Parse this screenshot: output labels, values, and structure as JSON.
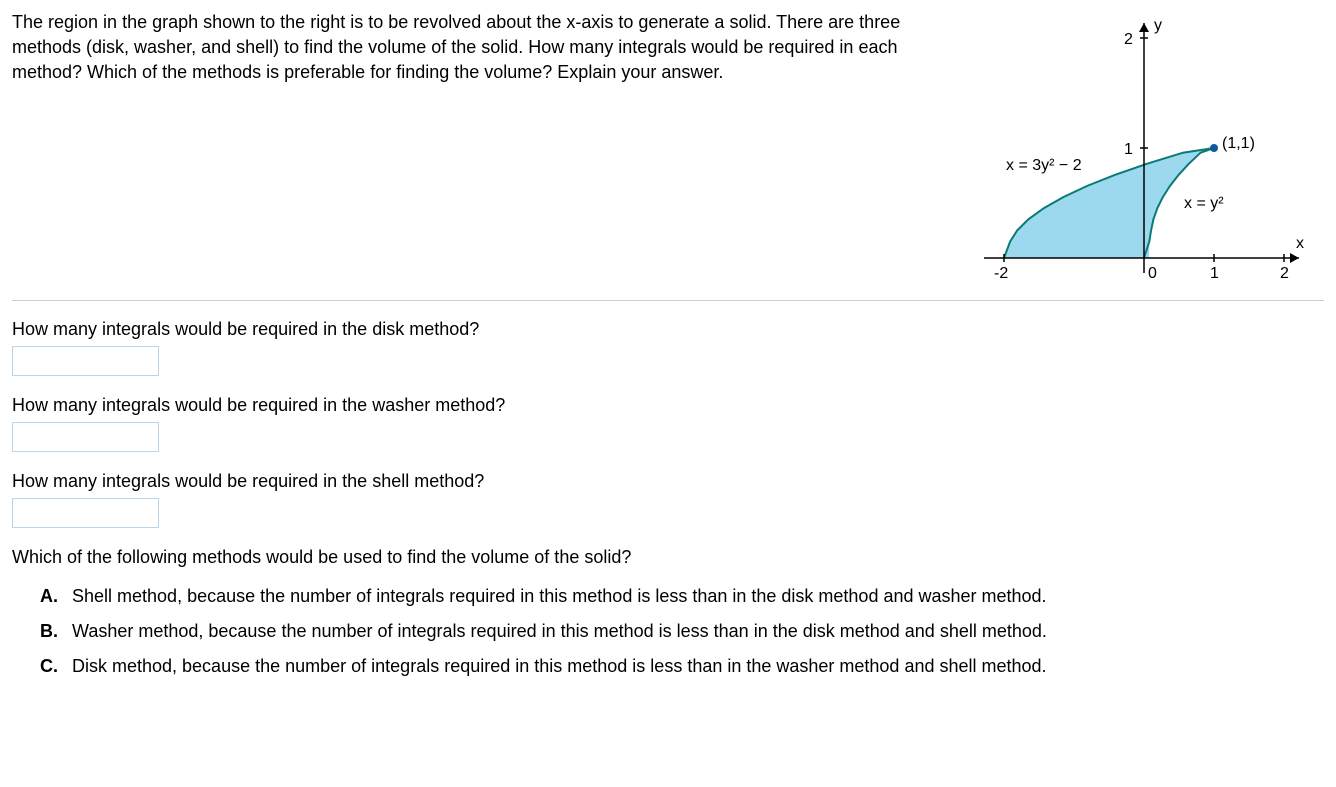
{
  "problem": "The region in the graph shown to the right is to be revolved about the x-axis to generate a solid. There are three methods (disk, washer, and shell) to find the volume of the solid. How many integrals would be required in each method? Which of the methods is preferable for finding the volume? Explain your answer.",
  "figure": {
    "y_label": "y",
    "x_label": "x",
    "tick_y2": "2",
    "tick_y1": "1",
    "tick_xm2": "-2",
    "tick_x0": "0",
    "tick_x1": "1",
    "tick_x2": "2",
    "point_label": "(1,1)",
    "curve1_label": "x = 3y² − 2",
    "curve2_label": "x = y²"
  },
  "q1": "How many integrals would be required in the disk method?",
  "q2": "How many integrals would be required in the washer method?",
  "q3": "How many integrals would be required in the shell method?",
  "q4": "Which of the following methods would be used to find the volume of the solid?",
  "options": {
    "A": {
      "letter": "A.",
      "text": "Shell method, because the number of integrals required in this method is less than in the disk method and washer method."
    },
    "B": {
      "letter": "B.",
      "text": "Washer method, because the number of integrals required in this method is less than in the disk method and shell method."
    },
    "C": {
      "letter": "C.",
      "text": "Disk method, because the number of integrals required in this method is less than in the washer method and shell method."
    }
  },
  "chart_data": {
    "type": "area",
    "title": "",
    "xlabel": "x",
    "ylabel": "y",
    "xlim": [
      -2,
      2
    ],
    "ylim": [
      0,
      2
    ],
    "annotations": [
      "(1,1)"
    ],
    "series": [
      {
        "name": "x = 3y² − 2",
        "equation": "x = 3y^2 - 2",
        "y": [
          0,
          0.2,
          0.4,
          0.6,
          0.8,
          1.0
        ],
        "x": [
          -2,
          -1.88,
          -1.52,
          -0.92,
          -0.08,
          1.0
        ]
      },
      {
        "name": "x = y²",
        "equation": "x = y^2",
        "y": [
          0,
          0.2,
          0.4,
          0.6,
          0.8,
          1.0
        ],
        "x": [
          0,
          0.04,
          0.16,
          0.36,
          0.64,
          1.0
        ]
      }
    ],
    "region": "bounded by x=3y²−2 on the left, x=y² on the right, y=0 below, meeting at (1,1)"
  }
}
